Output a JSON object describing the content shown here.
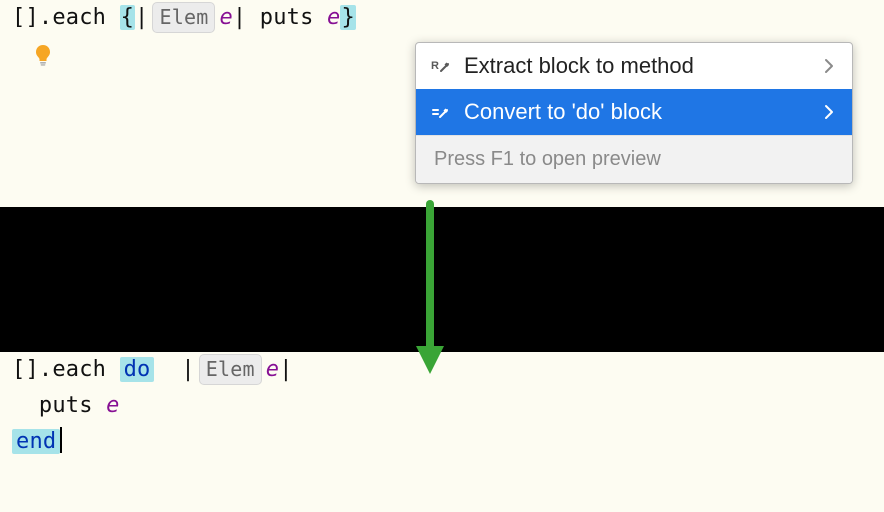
{
  "editor_top": {
    "line1": {
      "open_bracket": "[]",
      "dot_each": ".each ",
      "brace_open": "{",
      "pipe_open": "|",
      "param_hint": "Elem",
      "param_name": "e",
      "pipe_close": "|",
      "puts": " puts ",
      "arg": "e",
      "brace_close": "}"
    }
  },
  "menu": {
    "items": [
      {
        "label": "Extract block to method",
        "icon": "refactor-icon",
        "selected": false
      },
      {
        "label": "Convert to 'do' block",
        "icon": "edit-icon",
        "selected": true
      }
    ],
    "hint": "Press F1 to open preview"
  },
  "editor_bottom": {
    "line1": {
      "open_bracket": "[]",
      "dot_each": ".each ",
      "do": "do",
      "space": "  ",
      "pipe_open": "|",
      "param_hint": "Elem",
      "param_name": "e",
      "pipe_close": "|"
    },
    "line2_indent": "  ",
    "line2_puts": "puts ",
    "line2_arg": "e",
    "line3_end": "end"
  },
  "colors": {
    "highlight": "#a6e3e9",
    "menu_selected": "#1f76e5",
    "arrow": "#3aa536"
  }
}
